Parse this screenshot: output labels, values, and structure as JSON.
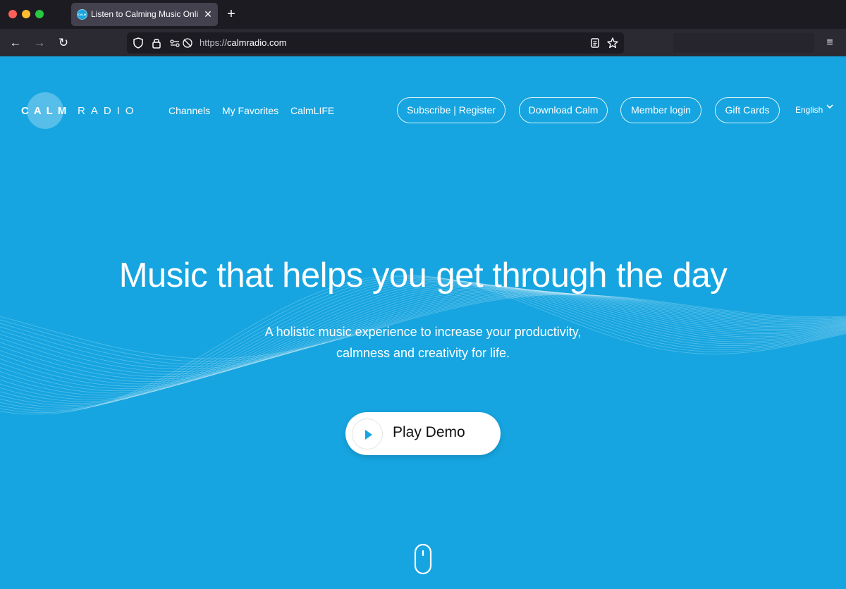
{
  "browser": {
    "tab": {
      "favicon_text": "CALM",
      "title": "Listen to Calming Music Online –",
      "close": "✕"
    },
    "new_tab": "+",
    "nav": {
      "back": "←",
      "forward": "→",
      "reload": "↻"
    },
    "url": {
      "scheme": "https://",
      "host": "calmradio.com"
    },
    "menu": "≡"
  },
  "site": {
    "logo": {
      "calm": "CALM",
      "radio": "RADIO"
    },
    "nav_links": [
      "Channels",
      "My Favorites",
      "CalmLIFE"
    ],
    "buttons": {
      "subscribe": "Subscribe | Register",
      "download": "Download Calm",
      "login": "Member login",
      "gift": "Gift Cards"
    },
    "language": "English",
    "hero": {
      "headline": "Music that helps you get through the day",
      "subline_1": "A holistic music experience to increase your productivity,",
      "subline_2": "calmness and creativity for life."
    },
    "demo_button": "Play Demo"
  },
  "colors": {
    "page_bg": "#16a5e0",
    "browser_bg": "#1c1b22",
    "toolbar_bg": "#2b2a33",
    "tab_bg": "#42414d"
  },
  "icons": [
    "shield-icon",
    "lock-icon",
    "permissions-icon",
    "reader-icon",
    "star-icon",
    "mouse-scroll-icon",
    "play-icon"
  ]
}
